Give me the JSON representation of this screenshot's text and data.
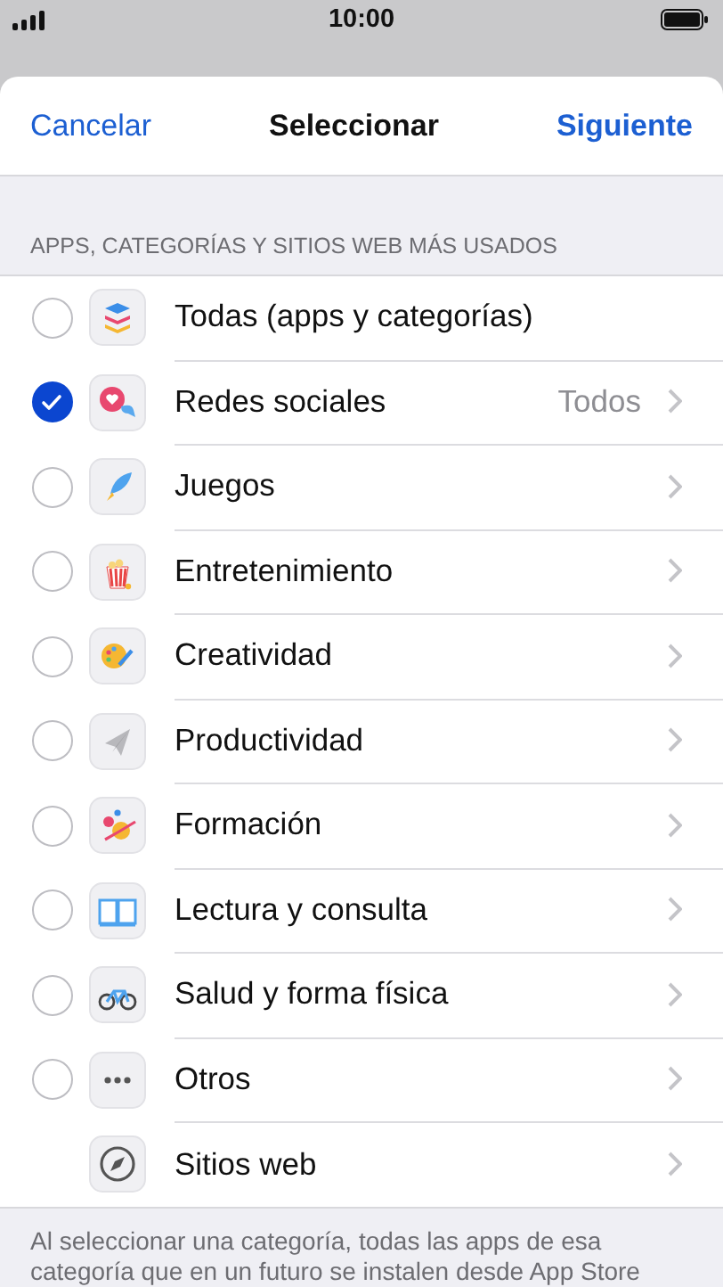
{
  "status_bar": {
    "time": "10:00"
  },
  "sheet": {
    "cancel": "Cancelar",
    "title": "Seleccionar",
    "next": "Siguiente"
  },
  "section_header": "APPS, CATEGORÍAS Y SITIOS WEB MÁS USADOS",
  "items": [
    {
      "kind": "category",
      "label": "Todas (apps y categorías)",
      "selected": false,
      "chevron": false
    },
    {
      "kind": "category",
      "label": "Redes sociales",
      "selected": true,
      "chevron": true,
      "detail": "Todos"
    },
    {
      "kind": "category",
      "label": "Juegos",
      "selected": false,
      "chevron": true
    },
    {
      "kind": "category",
      "label": "Entretenimiento",
      "selected": false,
      "chevron": true
    },
    {
      "kind": "category",
      "label": "Creatividad",
      "selected": false,
      "chevron": true
    },
    {
      "kind": "category",
      "label": "Productividad",
      "selected": false,
      "chevron": true
    },
    {
      "kind": "category",
      "label": "Formación",
      "selected": false,
      "chevron": true
    },
    {
      "kind": "category",
      "label": "Lectura y consulta",
      "selected": false,
      "chevron": true
    },
    {
      "kind": "category",
      "label": "Salud y forma física",
      "selected": false,
      "chevron": true
    },
    {
      "kind": "category",
      "label": "Otros",
      "selected": false,
      "chevron": true
    },
    {
      "kind": "websites",
      "label": "Sitios web",
      "chevron": true
    }
  ],
  "footer": "Al seleccionar una categoría, todas las apps de esa categoría que en un futuro se instalen desde App Store"
}
